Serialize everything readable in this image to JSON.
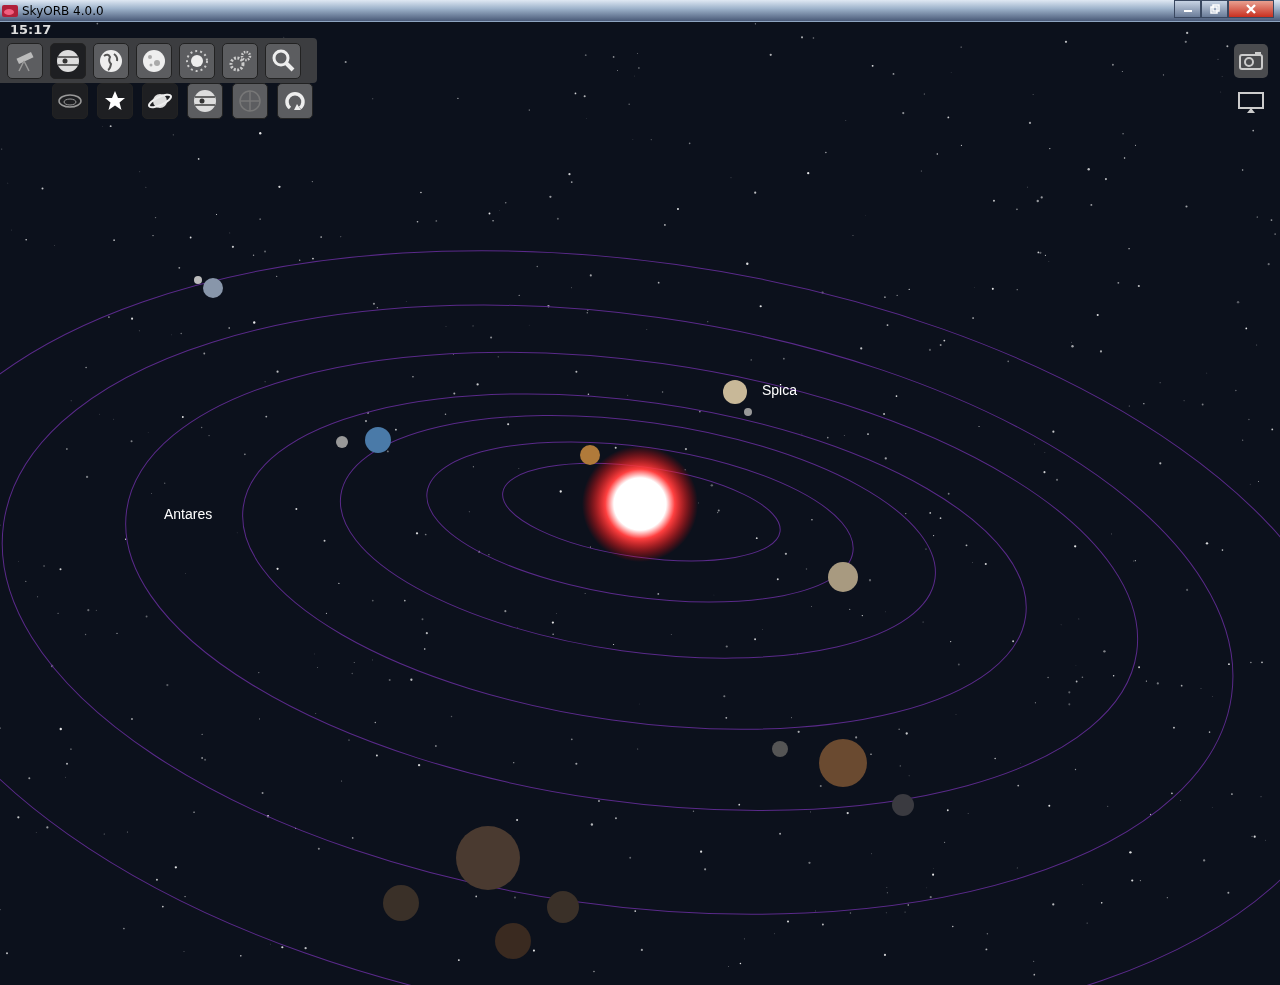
{
  "window": {
    "title": "SkyORB 4.0.0"
  },
  "clock": "15:17",
  "toolbar": {
    "top_row": [
      {
        "selected": false
      },
      {
        "selected": true
      },
      {
        "selected": false
      },
      {
        "selected": false
      },
      {
        "selected": false
      },
      {
        "selected": false
      },
      {
        "selected": false
      }
    ],
    "bottom_row": [
      {
        "selected": true
      },
      {
        "selected": true
      },
      {
        "selected": true
      },
      {
        "selected": false
      },
      {
        "selected": false
      },
      {
        "selected": false
      }
    ]
  },
  "sky_labels": [
    {
      "text": "Spica"
    },
    {
      "text": "Antares"
    }
  ]
}
